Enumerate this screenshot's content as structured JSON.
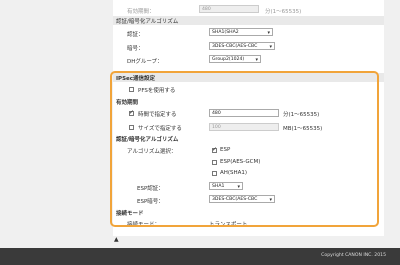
{
  "top": {
    "lifetime_label": "有効期間：",
    "lifetime_value": "480",
    "lifetime_unit": "分(1〜65535)",
    "algo_heading": "認証/暗号化アルゴリズム",
    "auth_label": "認証：",
    "auth_value": "SHA1(SHA2",
    "enc_label": "暗号：",
    "enc_value": "3DES-CBC(AES-CBC",
    "dh_label": "DHグループ：",
    "dh_value": "Group2(1024)"
  },
  "ipsec": {
    "title": "IPSec通信設定",
    "pfs_label": "PFSを使用する",
    "validity_heading": "有効期間",
    "time_label": "時間で指定する",
    "time_value": "480",
    "time_unit": "分(1〜65535)",
    "size_label": "サイズで指定する",
    "size_value": "100",
    "size_unit": "MB(1〜65535)",
    "algo_heading": "認証/暗号化アルゴリズム",
    "algo_label": "アルゴリズム選択：",
    "esp_label": "ESP",
    "esp_gcm_label": "ESP(AES-GCM)",
    "ah_label": "AH(SHA1)",
    "esp_auth_label": "ESP認証：",
    "esp_auth_value": "SHA1",
    "esp_enc_label": "ESP暗号：",
    "esp_enc_value": "3DES-CBC(AES-CBC",
    "mode_heading": "接続モード",
    "mode_label": "接続モード：",
    "mode_value": "トランスポート"
  },
  "footer": {
    "top_icon": "arrow-up-icon",
    "copyright": "Copyright CANON INC. 2015"
  }
}
